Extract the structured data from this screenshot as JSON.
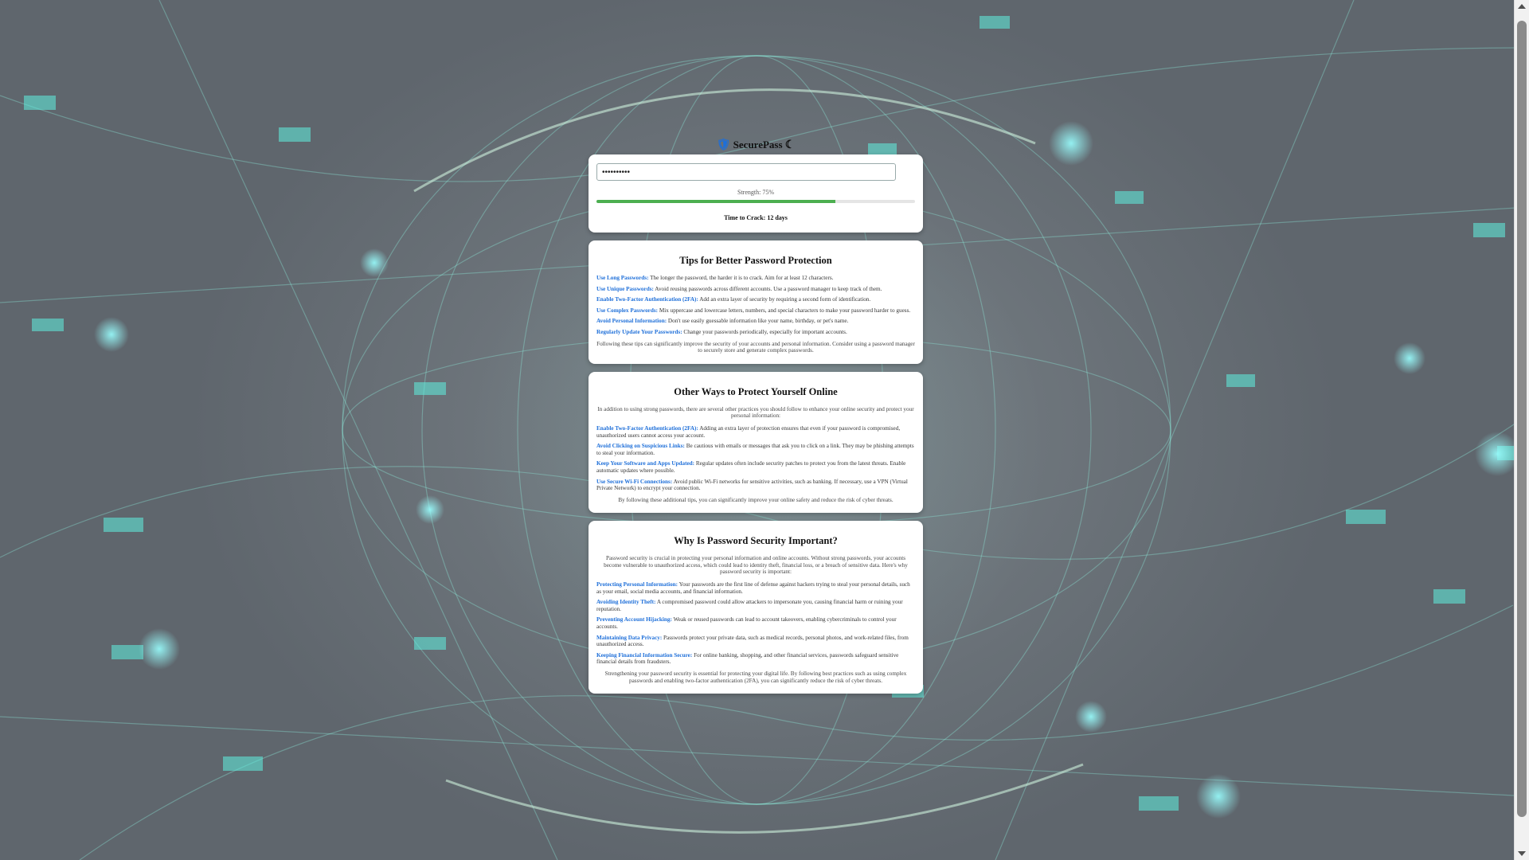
{
  "app": {
    "title": "SecurePass"
  },
  "password": {
    "value": "••••••••••",
    "strength_label": "Strength: 75%",
    "strength_percent": 75,
    "strength_color": "#4caf50",
    "time_to_crack": "Time to Crack: 12 days"
  },
  "tips": {
    "title": "Tips for Better Password Protection",
    "items": [
      {
        "label": "Use Long Passwords:",
        "text": " The longer the password, the harder it is to crack. Aim for at least 12 characters."
      },
      {
        "label": "Use Unique Passwords:",
        "text": " Avoid reusing passwords across different accounts. Use a password manager to keep track of them."
      },
      {
        "label": "Enable Two-Factor Authentication (2FA):",
        "text": " Add an extra layer of security by requiring a second form of identification."
      },
      {
        "label": "Use Complex Passwords:",
        "text": " Mix uppercase and lowercase letters, numbers, and special characters to make your password harder to guess."
      },
      {
        "label": "Avoid Personal Information:",
        "text": " Don't use easily guessable information like your name, birthday, or pet's name."
      },
      {
        "label": "Regularly Update Your Passwords:",
        "text": " Change your passwords periodically, especially for important accounts."
      }
    ],
    "note": "Following these tips can significantly improve the security of your accounts and personal information. Consider using a password manager to securely store and generate complex passwords."
  },
  "other": {
    "title": "Other Ways to Protect Yourself Online",
    "intro": "In addition to using strong passwords, there are several other practices you should follow to enhance your online security and protect your personal information:",
    "items": [
      {
        "label": "Enable Two-Factor Authentication (2FA):",
        "text": " Adding an extra layer of protection ensures that even if your password is compromised, unauthorized users cannot access your account."
      },
      {
        "label": "Avoid Clicking on Suspicious Links:",
        "text": " Be cautious with emails or messages that ask you to click on a link. They may be phishing attempts to steal your information."
      },
      {
        "label": "Keep Your Software and Apps Updated:",
        "text": " Regular updates often include security patches to protect you from the latest threats. Enable automatic updates where possible."
      },
      {
        "label": "Use Secure Wi-Fi Connections:",
        "text": " Avoid public Wi-Fi networks for sensitive activities, such as banking. If necessary, use a VPN (Virtual Private Network) to encrypt your connection."
      }
    ],
    "note": "By following these additional tips, you can significantly improve your online safety and reduce the risk of cyber threats."
  },
  "why": {
    "title": "Why Is Password Security Important?",
    "intro": "Password security is crucial in protecting your personal information and online accounts. Without strong passwords, your accounts become vulnerable to unauthorized access, which could lead to identity theft, financial loss, or a breach of sensitive data. Here's why password security is important:",
    "items": [
      {
        "label": "Protecting Personal Information:",
        "text": " Your passwords are the first line of defense against hackers trying to steal your personal details, such as your email, social media accounts, and financial information."
      },
      {
        "label": "Avoiding Identity Theft:",
        "text": " A compromised password could allow attackers to impersonate you, causing financial harm or ruining your reputation."
      },
      {
        "label": "Preventing Account Hijacking:",
        "text": " Weak or reused passwords can lead to account takeovers, enabling cybercriminals to control your accounts."
      },
      {
        "label": "Maintaining Data Privacy:",
        "text": " Passwords protect your private data, such as medical records, personal photos, and work-related files, from unauthorized access."
      },
      {
        "label": "Keeping Financial Information Secure:",
        "text": " For online banking, shopping, and other financial services, passwords safeguard sensitive financial details from fraudsters."
      }
    ],
    "note": "Strengthening your password security is essential for protecting your digital life. By following best practices such as using complex passwords and enabling two-factor authentication (2FA), you can significantly reduce the risk of cyber threats."
  }
}
